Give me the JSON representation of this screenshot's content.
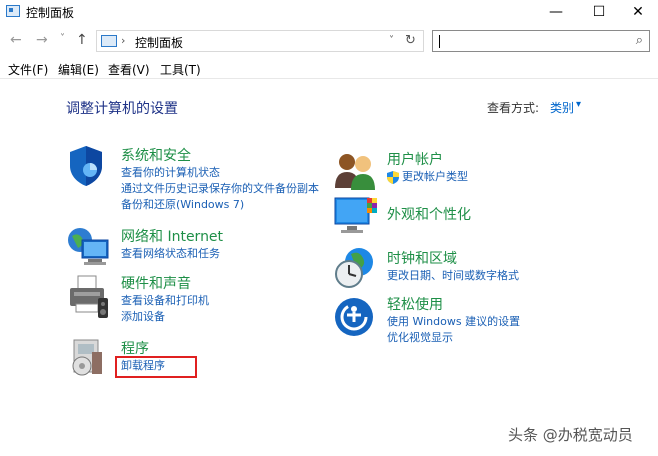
{
  "window": {
    "title": "控制面板",
    "minimize": "—",
    "maximize": "☐",
    "close": "✕"
  },
  "address": {
    "back": "←",
    "forward": "→",
    "recent": "˅",
    "up": "↑",
    "separator": "›",
    "path": "控制面板",
    "dropdown": "˅",
    "refresh": "↻",
    "search_placeholder": "",
    "search_icon": "⌕"
  },
  "menu": [
    "文件(F)",
    "编辑(E)",
    "查看(V)",
    "工具(T)"
  ],
  "heading": "调整计算机的设置",
  "view_by": {
    "label": "查看方式:",
    "value": "类别",
    "arrow": "▾"
  },
  "categories": [
    {
      "title": "系统和安全",
      "icon": "shield-icon",
      "links": [
        "查看你的计算机状态",
        "通过文件历史记录保存你的文件备份副本",
        "备份和还原(Windows 7)"
      ]
    },
    {
      "title": "网络和 Internet",
      "icon": "network-icon",
      "links": [
        "查看网络状态和任务"
      ]
    },
    {
      "title": "硬件和声音",
      "icon": "printer-icon",
      "links": [
        "查看设备和打印机",
        "添加设备"
      ]
    },
    {
      "title": "程序",
      "icon": "programs-icon",
      "links": [
        "卸载程序"
      ]
    },
    {
      "title": "用户帐户",
      "icon": "users-icon",
      "links": [
        "更改帐户类型"
      ]
    },
    {
      "title": "外观和个性化",
      "icon": "monitor-icon",
      "links": []
    },
    {
      "title": "时钟和区域",
      "icon": "clock-globe-icon",
      "links": [
        "更改日期、时间或数字格式"
      ]
    },
    {
      "title": "轻松使用",
      "icon": "ease-of-access-icon",
      "links": [
        "使用 Windows 建议的设置",
        "优化视觉显示"
      ]
    }
  ],
  "colors": {
    "category_title": "#1e8f47",
    "link": "#1a5fb4",
    "heading": "#1e3287",
    "highlight_box": "#e02020"
  },
  "watermark": "头条 @办税宽动员"
}
